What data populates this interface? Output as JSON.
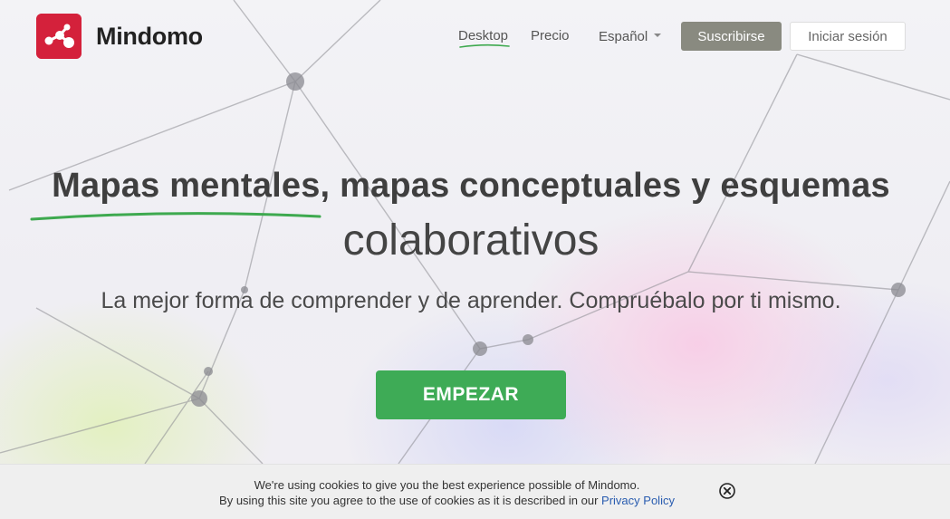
{
  "header": {
    "brand": "Mindomo",
    "nav": {
      "desktop": "Desktop",
      "pricing": "Precio",
      "language": "Español"
    },
    "subscribe_label": "Suscribirse",
    "login_label": "Iniciar sesión"
  },
  "hero": {
    "headline_highlight": "Mapas mentales,",
    "headline_rest": " mapas conceptuales y esquemas",
    "headline_line2": "colaborativos",
    "subtitle": "La mejor forma de comprender y de aprender. Compruébalo por ti mismo.",
    "cta_label": "EMPEZAR"
  },
  "cookie_banner": {
    "line1": "We're using cookies to give you the best experience possible of Mindomo.",
    "line2": "By using this site you agree to the use of cookies as it is described in our ",
    "link_label": "Privacy Policy"
  },
  "colors": {
    "brand_red": "#d4213b",
    "cta_green": "#3eab56",
    "accent_underline": "#3ea94f",
    "subscribe_bg": "#898a80",
    "link_blue": "#2a5db0"
  },
  "icons": [
    "mindomo-logo-icon",
    "chevron-down-icon",
    "close-circle-icon"
  ]
}
